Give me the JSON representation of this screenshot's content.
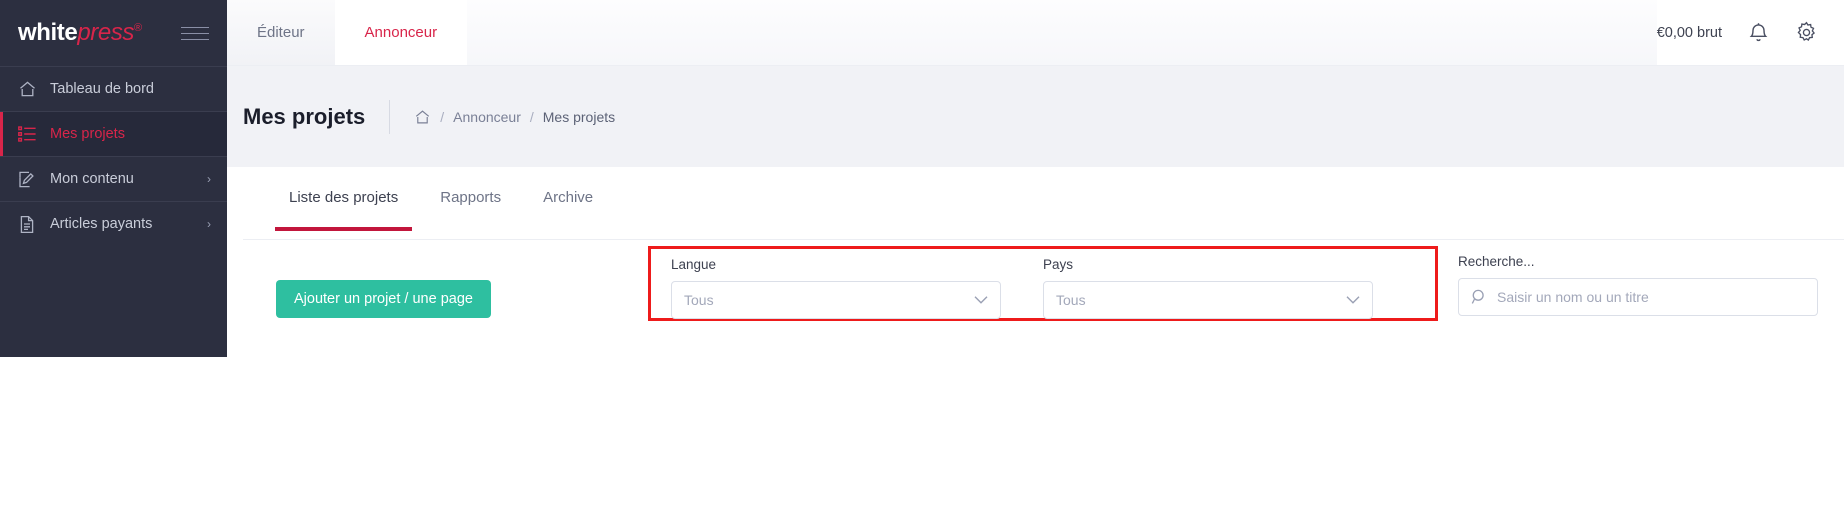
{
  "brand": {
    "name_primary": "white",
    "name_secondary": "press",
    "registered_mark": "®",
    "menu_icon": "hamburger-icon"
  },
  "sidebar": {
    "items": [
      {
        "label": "Tableau de bord",
        "icon": "home-icon",
        "active": false,
        "has_submenu": false
      },
      {
        "label": "Mes projets",
        "icon": "list-icon",
        "active": true,
        "has_submenu": false
      },
      {
        "label": "Mon contenu",
        "icon": "edit-square-icon",
        "active": false,
        "has_submenu": true,
        "chevron": "›"
      },
      {
        "label": "Articles payants",
        "icon": "document-icon",
        "active": false,
        "has_submenu": true,
        "chevron": "›"
      }
    ]
  },
  "topbar": {
    "tabs": [
      {
        "label": "Éditeur",
        "active": false
      },
      {
        "label": "Annonceur",
        "active": true
      }
    ],
    "balance": "€0,00 brut",
    "notification_icon": "bell-icon",
    "settings_icon": "gear-icon"
  },
  "page_header": {
    "title": "Mes projets",
    "breadcrumb": {
      "home_icon": "home-icon",
      "items": [
        {
          "label": "Annonceur",
          "current": false
        },
        {
          "label": "Mes projets",
          "current": true
        }
      ],
      "separator": "/"
    }
  },
  "content_tabs": [
    {
      "label": "Liste des projets",
      "active": true
    },
    {
      "label": "Rapports",
      "active": false
    },
    {
      "label": "Archive",
      "active": false
    }
  ],
  "toolbar": {
    "add_label": "Ajouter un projet / une page"
  },
  "filters": {
    "highlight_color": "#ee1b1b",
    "language": {
      "label": "Langue",
      "value": "Tous",
      "chevron_icon": "chevron-down-icon"
    },
    "country": {
      "label": "Pays",
      "value": "Tous",
      "chevron_icon": "chevron-down-icon"
    }
  },
  "search": {
    "label": "Recherche...",
    "placeholder": "Saisir un nom ou un titre",
    "value": "",
    "icon": "search-icon"
  },
  "colors": {
    "sidebar_bg": "#2c2f40",
    "sidebar_active_bg": "#26293a",
    "accent_red": "#d8254a",
    "tab_underline": "#c2163c",
    "button_green": "#2ebfa0",
    "page_bg": "#f1f2f6",
    "highlight_red": "#ee1b1b"
  }
}
